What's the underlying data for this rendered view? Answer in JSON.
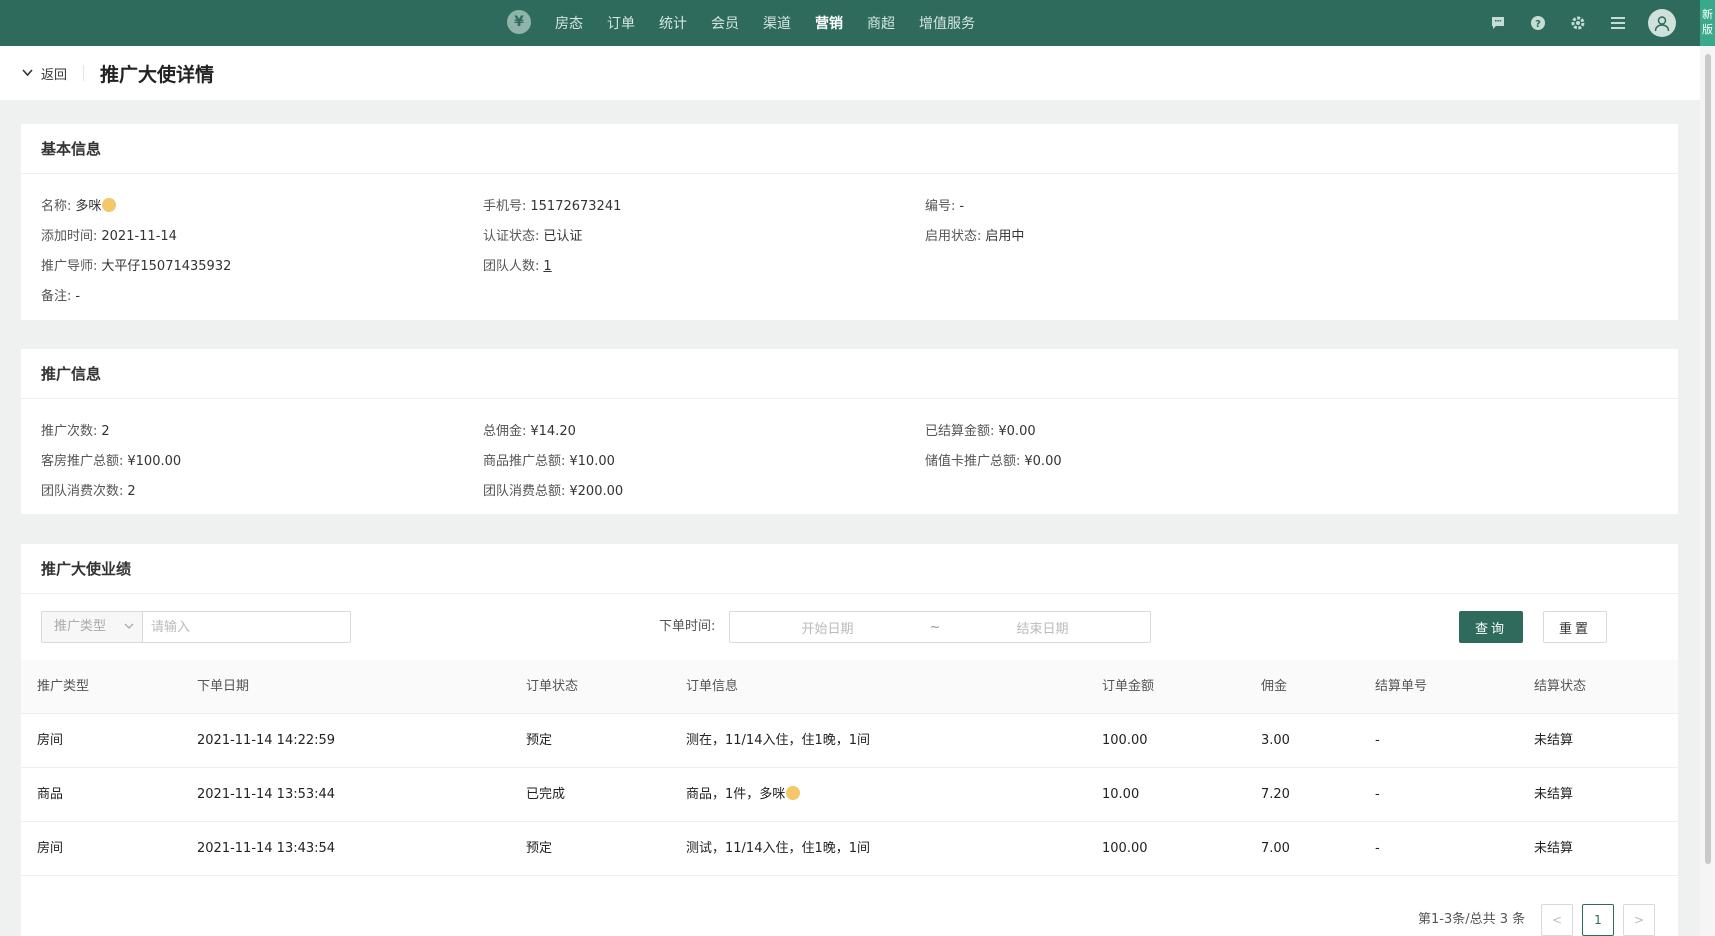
{
  "nav": {
    "logo": "¥",
    "items": [
      {
        "label": "房态",
        "active": false
      },
      {
        "label": "订单",
        "active": false
      },
      {
        "label": "统计",
        "active": false
      },
      {
        "label": "会员",
        "active": false
      },
      {
        "label": "渠道",
        "active": false
      },
      {
        "label": "营销",
        "active": true
      },
      {
        "label": "商超",
        "active": false
      },
      {
        "label": "增值服务",
        "active": false
      }
    ],
    "right_icons": [
      "message-icon",
      "help-icon",
      "settings-icon",
      "menu-icon",
      "user-avatar-icon"
    ],
    "new_version": "新版"
  },
  "header": {
    "back_label": "返回",
    "title": "推广大使详情"
  },
  "basic_info": {
    "title": "基本信息",
    "name_label": "名称:",
    "name_value": "多咪",
    "phone_label": "手机号:",
    "phone_value": "15172673241",
    "code_label": "编号:",
    "code_value": "-",
    "added_label": "添加时间:",
    "added_value": "2021-11-14",
    "auth_label": "认证状态:",
    "auth_value": "已认证",
    "enabled_label": "启用状态:",
    "enabled_value": "启用中",
    "mentor_label": "推广导师:",
    "mentor_value": "大平仔15071435932",
    "team_label": "团队人数:",
    "team_value": "1",
    "remark_label": "备注:",
    "remark_value": "-"
  },
  "promo_info": {
    "title": "推广信息",
    "count_label": "推广次数:",
    "count_value": "2",
    "commission_label": "总佣金:",
    "commission_value": "¥14.20",
    "settled_label": "已结算金额:",
    "settled_value": "¥0.00",
    "room_label": "客房推广总额:",
    "room_value": "¥100.00",
    "goods_label": "商品推广总额:",
    "goods_value": "¥10.00",
    "card_label": "储值卡推广总额:",
    "card_value": "¥0.00",
    "team_count_label": "团队消费次数:",
    "team_count_value": "2",
    "team_total_label": "团队消费总额:",
    "team_total_value": "¥200.00"
  },
  "performance": {
    "title": "推广大使业绩",
    "type_select": "推广类型",
    "input_placeholder": "请输入",
    "date_label": "下单时间:",
    "date_start": "开始日期",
    "date_sep": "~",
    "date_end": "结束日期",
    "query_btn": "查询",
    "reset_btn": "重置",
    "columns": [
      "推广类型",
      "下单日期",
      "订单状态",
      "订单信息",
      "订单金额",
      "佣金",
      "结算单号",
      "结算状态"
    ],
    "rows": [
      [
        "房间",
        "2021-11-14 14:22:59",
        "预定",
        "测在，11/14入住，住1晚，1间",
        "100.00",
        "3.00",
        "-",
        "未结算"
      ],
      [
        "商品",
        "2021-11-14 13:53:44",
        "已完成",
        "商品，1件，多咪",
        "10.00",
        "7.20",
        "-",
        "未结算"
      ],
      [
        "房间",
        "2021-11-14 13:43:54",
        "预定",
        "测试，11/14入住，住1晚，1间",
        "100.00",
        "7.00",
        "-",
        "未结算"
      ]
    ],
    "pagination_total": "第1-3条/总共 3 条",
    "prev": "<",
    "page": "1",
    "next": ">"
  },
  "colors": {
    "brand": "#2e6b5c",
    "link": "#1e88e5"
  }
}
